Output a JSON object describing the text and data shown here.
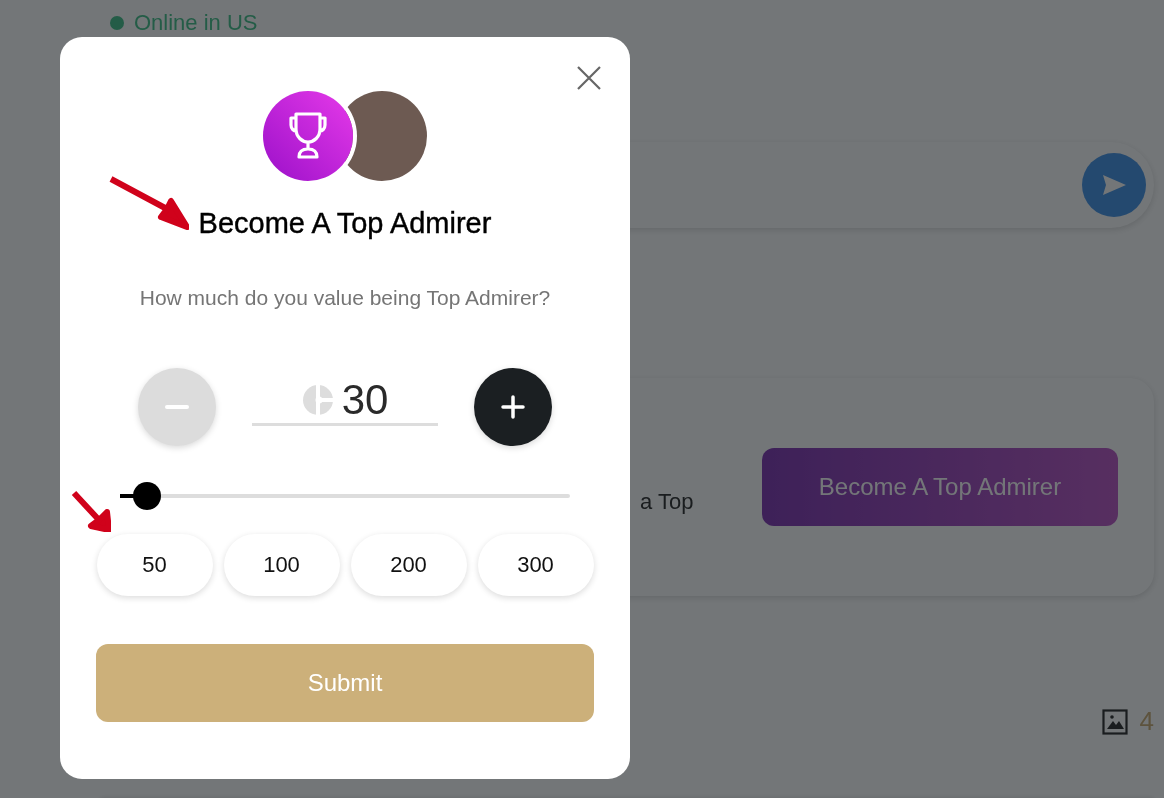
{
  "background": {
    "status_text": "Online in US",
    "promo_card": {
      "text": "a Top",
      "button": "Become A Top Admirer"
    },
    "media_count": "4"
  },
  "modal": {
    "title": "Become A Top Admirer",
    "question": "How much do you value being Top Admirer?",
    "amount": "30",
    "decrement_disabled": true,
    "slider": {
      "level": 0.06
    },
    "presets": [
      {
        "label": "50"
      },
      {
        "label": "100"
      },
      {
        "label": "200"
      },
      {
        "label": "300"
      }
    ],
    "submit": "Submit"
  }
}
